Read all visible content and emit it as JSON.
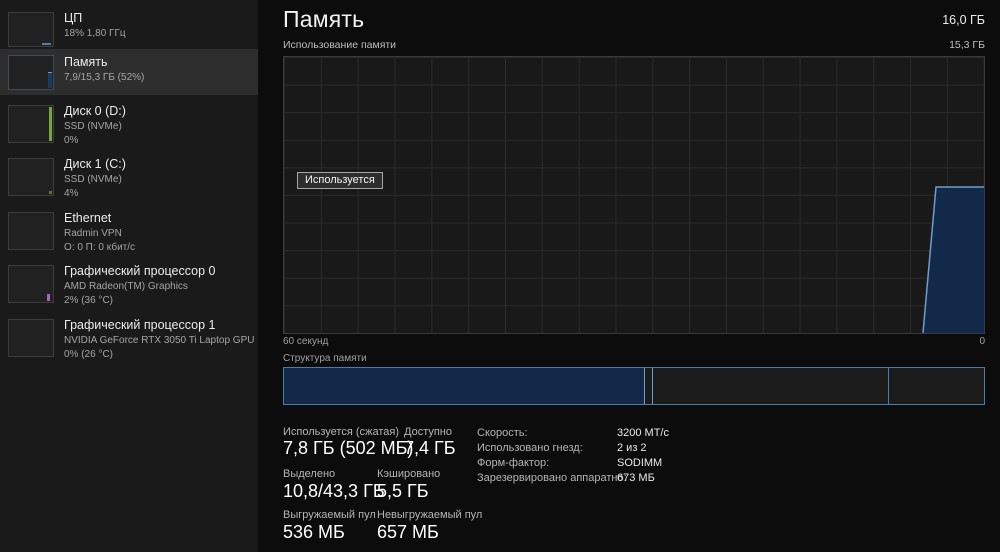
{
  "header": {
    "title": "Память",
    "total": "16,0 ГБ"
  },
  "sidebar": {
    "items": [
      {
        "title": "ЦП",
        "line2": "18%  1,80 ГГц"
      },
      {
        "title": "Память",
        "line2": "7,9/15,3 ГБ (52%)"
      },
      {
        "title": "Диск 0 (D:)",
        "line2": "SSD (NVMe)",
        "line3": "0%"
      },
      {
        "title": "Диск 1 (C:)",
        "line2": "SSD (NVMe)",
        "line3": "4%"
      },
      {
        "title": "Ethernet",
        "line2": "Radmin VPN",
        "line3": "О: 0 П: 0 кбит/с"
      },
      {
        "title": "Графический процессор 0",
        "line2": "AMD Radeon(TM) Graphics",
        "line3": "2% (36 °C)"
      },
      {
        "title": "Графический процессор 1",
        "line2": "NVIDIA GeForce RTX 3050 Ti Laptop GPU",
        "line3": "0% (26 °C)"
      }
    ]
  },
  "usage_chart": {
    "label": "Использование памяти",
    "max_label": "15,3 ГБ",
    "x_left": "60 секунд",
    "x_right": "0",
    "tooltip": "Используется"
  },
  "composition": {
    "label": "Структура памяти"
  },
  "stats": {
    "pairs": [
      {
        "label": "Используется (сжатая)",
        "value": "7,8 ГБ (502 МБ)"
      },
      {
        "label": "Доступно",
        "value": "7,4 ГБ"
      },
      {
        "label": "Выделено",
        "value": "10,8/43,3 ГБ"
      },
      {
        "label": "Кэшировано",
        "value": "5,5 ГБ"
      },
      {
        "label": "Выгружаемый пул",
        "value": "536 МБ"
      },
      {
        "label": "Невыгружаемый пул",
        "value": "657 МБ"
      }
    ]
  },
  "details": {
    "rows": [
      {
        "label": "Скорость:",
        "value": "3200 МТ/с"
      },
      {
        "label": "Использовано гнезд:",
        "value": "2 из 2"
      },
      {
        "label": "Форм-фактор:",
        "value": "SODIMM"
      },
      {
        "label": "Зарезервировано аппаратно:",
        "value": "673 МБ"
      }
    ]
  },
  "chart_data": {
    "type": "area",
    "title": "Использование памяти",
    "ylabel": "ГБ",
    "ylim": [
      0,
      15.3
    ],
    "x_left_label": "60 секунд",
    "x_right_label": "0",
    "visible_series_label": "Используется",
    "used_gb": 7.9,
    "total_gb": 15.3,
    "used_fraction": 0.52,
    "series": [
      {
        "name": "Используется",
        "x_fraction_of_width": [
          0.0,
          0.913,
          0.932,
          1.0
        ],
        "values_gb": [
          0,
          0,
          7.9,
          7.9
        ]
      }
    ],
    "composition_bar_fractions": [
      0.514,
      0.012,
      0.337,
      0.137
    ],
    "grid": {
      "columns": 19,
      "rows": 10
    }
  },
  "colors": {
    "accent_blue_fill": "#13294a",
    "accent_blue_line": "#6f9dc9",
    "bar_border": "#4e7ba8",
    "disk_green": "#74a83e",
    "gpu_purple": "#a963c0",
    "sidebar_bg": "#1a1a1a",
    "selected_bg": "#2e2e2e",
    "main_bg": "#0c0c0c"
  }
}
